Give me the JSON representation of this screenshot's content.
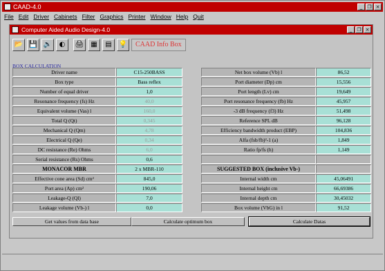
{
  "app": {
    "title": "CAAD-4.0"
  },
  "window_buttons": [
    "_",
    "❐",
    "×"
  ],
  "menu": [
    "File",
    "Edit",
    "Driver",
    "Cabinets",
    "Filter",
    "Graphics",
    "Printer",
    "Window",
    "Help",
    "Quit"
  ],
  "child": {
    "title": "Computer Aided Audio Design-4.0"
  },
  "toolbar": {
    "icons": [
      "open-file-icon",
      "save-disk-icon",
      "speaker-icon",
      "vent-icon",
      "printer-icon",
      "grid-icon",
      "chart-icon",
      "lightbulb-icon"
    ],
    "glyphs": [
      "📂",
      "💾",
      "🔊",
      "◐",
      "🖨",
      "▦",
      "▤",
      "💡"
    ],
    "info_label": "CAAD Info Box"
  },
  "section_header": "BOX CALCULATION",
  "left_rows": [
    {
      "label": "Driver name",
      "value": "C15-250BASS",
      "dim": false
    },
    {
      "label": "Box type",
      "value": "Bass reflex",
      "dim": false
    },
    {
      "label": "Number of equal driver",
      "value": "1,0",
      "dim": false
    },
    {
      "label": "Resonance frequency (fs) Hz",
      "value": "40,0",
      "dim": true
    },
    {
      "label": "Equivalent volume (Vas) l",
      "value": "160,0",
      "dim": true
    },
    {
      "label": "Total Q (Qt)",
      "value": "0,345",
      "dim": true
    },
    {
      "label": "Mechanical Q (Qm)",
      "value": "4,78",
      "dim": true
    },
    {
      "label": "Electrical Q (Qe)",
      "value": "0,34",
      "dim": true
    },
    {
      "label": "DC resistance (Re) Ohms",
      "value": "6,0",
      "dim": true
    },
    {
      "label": "Serial resistance (Rs) Ohms",
      "value": "0,6",
      "dim": false
    },
    {
      "label": "MONACOR MBR",
      "value": "2 x MBR-110",
      "dim": false,
      "header": true
    },
    {
      "label": "Effective cone area (Sd) cm²",
      "value": "845,0",
      "dim": false
    },
    {
      "label": "Port area (Ap) cm²",
      "value": "190,06",
      "dim": false
    },
    {
      "label": "Leakage-Q (Ql)",
      "value": "7,0",
      "dim": false
    },
    {
      "label": "Leakage volume (Vb-) l",
      "value": "0,0",
      "dim": false
    }
  ],
  "right_rows": [
    {
      "label": "Net box volume (Vb) l",
      "value": "86,52"
    },
    {
      "label": "Port diameter (Dp) cm",
      "value": "15,556"
    },
    {
      "label": "Port length (Lv) cm",
      "value": "19,649"
    },
    {
      "label": "Port resonance frequency (fb) Hz",
      "value": "45,957"
    },
    {
      "label": "-3 dB frequency (f3) Hz",
      "value": "51,498"
    },
    {
      "label": "Reference SPL dB",
      "value": "96,128"
    },
    {
      "label": "Efficiency bandwidth product (EBP)",
      "value": "104,836"
    },
    {
      "label": "Alfa (fsb/fb)²-1 (a)",
      "value": "1,849"
    },
    {
      "label": "Ratio fp/fs (h)",
      "value": "1,149"
    },
    {
      "label": "",
      "value": ""
    },
    {
      "label": "SUGGESTED BOX (inclusive Vb-)",
      "value": "",
      "header": true
    },
    {
      "label": "Internal width cm",
      "value": "45,06491"
    },
    {
      "label": "Internal height cm",
      "value": "66,69386"
    },
    {
      "label": "Internal depth cm",
      "value": "30,45032"
    },
    {
      "label": "Box volume (VbG) in l",
      "value": "91,52"
    }
  ],
  "buttons": {
    "get_values": "Get values from data base",
    "calc_optimum": "Calculate optimum box",
    "calc_datas": "Calculate Datas"
  }
}
